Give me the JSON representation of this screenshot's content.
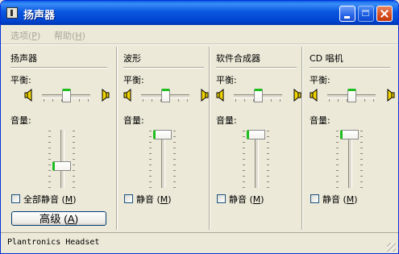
{
  "window": {
    "title": "扬声器"
  },
  "menu": [
    {
      "label": "选项",
      "key": "P"
    },
    {
      "label": "帮助",
      "key": "H"
    }
  ],
  "master": {
    "title": "扬声器",
    "balance_label": "平衡:",
    "volume_label": "音量:",
    "balance": 0.5,
    "volume": 0.35,
    "mute_label": "全部静音",
    "mute_key": "M",
    "mute_checked": false,
    "advanced_label": "高级",
    "advanced_key": "A"
  },
  "channels": [
    {
      "title": "波形",
      "balance_label": "平衡:",
      "volume_label": "音量:",
      "balance": 0.5,
      "volume": 1.0,
      "mute_label": "静音",
      "mute_key": "M",
      "mute_checked": false
    },
    {
      "title": "软件合成器",
      "balance_label": "平衡:",
      "volume_label": "音量:",
      "balance": 0.5,
      "volume": 1.0,
      "mute_label": "静音",
      "mute_key": "M",
      "mute_checked": false
    },
    {
      "title": "CD 唱机",
      "balance_label": "平衡:",
      "volume_label": "音量:",
      "balance": 0.5,
      "volume": 1.0,
      "mute_label": "静音",
      "mute_key": "M",
      "mute_checked": false
    }
  ],
  "status": {
    "text": "Plantronics Headset"
  },
  "colors": {
    "titlebar": "#0a57e0",
    "face": "#ece9d8",
    "thumb_accent": "#1fbd1f"
  },
  "icons": {
    "app": "speaker-app-icon",
    "speaker_left": "speaker-left-icon",
    "speaker_right": "speaker-right-icon"
  }
}
